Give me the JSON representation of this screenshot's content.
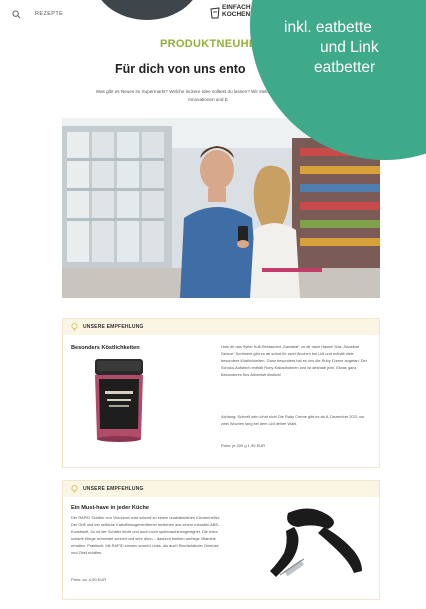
{
  "nav": {
    "menu_label": "REZEPTE"
  },
  "logo": {
    "line1": "EINFACH",
    "line2": "KOCHEN"
  },
  "header": {
    "kicker": "PRODUKTNEUHE",
    "title": "Für dich von uns ento",
    "intro": "Was gibt es Neues im Supermarkt? Welche leckere Idee solltest du lassen? Wir stellen dir hier neue Produkte, Innovationen und E"
  },
  "overlay": {
    "line1": "inkl. eatbette",
    "line2": "und Link",
    "line3": "eatbetter"
  },
  "card1": {
    "label": "UNSERE EMPFEHLUNG",
    "title": "Besonders Köstlichkeiten",
    "p1": "Hole dir das Sylter Kult-Restaurant „Sansibar“ zu dir nach Hause! Das „Sansibar Deluxe“-Sortiment gibt es ab sofort für zwei Wochen bei Lidl und enthält viele besondere Köstlichkeiten. Ganz besonders hat es uns die Ruby Creme angetan: Der Schoko-Aufstrich enthält Ruby-Kakaobohnen und ist deshalb pink. Etwas ganz Besonderes fürs Adventsfrühstück!",
    "p2": "Achtung: Schnell sein lohnt sich! Die Ruby Creme gibt es ab 6. Dezember 2021 nur zwei Wochen lang bei dem Lidl deiner Wahl.",
    "price": "Preis: je 200 g 1,99 EUR"
  },
  "card2": {
    "label": "UNSERE EMPFEHLUNG",
    "title": "Ein Must-have in jeder Küche",
    "p1": "Der RAPID Schäler von Victorinox wird schnell zu einem unablässlichen Küchenhelfer: Der Griff und der seitliche Kartoffelaugenentferner bestehen aus einem robusten ABS-Kunststoff. So ist der Schäler leicht und auch noch spülmaschinengeeignet. Die extra scharfe Klinge schneidet schnell und sehr dünn – dadurch bleiben wichtige Vitamine erhalten. Praktisch: Mit RAPID können sowohl Links- als auch Rechtshänder Gemüse und Obst schälen.",
    "price": "Preis: ca. 4,90 EUR"
  },
  "colors": {
    "accent_green": "#8fb13a",
    "overlay_teal": "#3faa8a",
    "card_head": "#fbf6e4"
  }
}
